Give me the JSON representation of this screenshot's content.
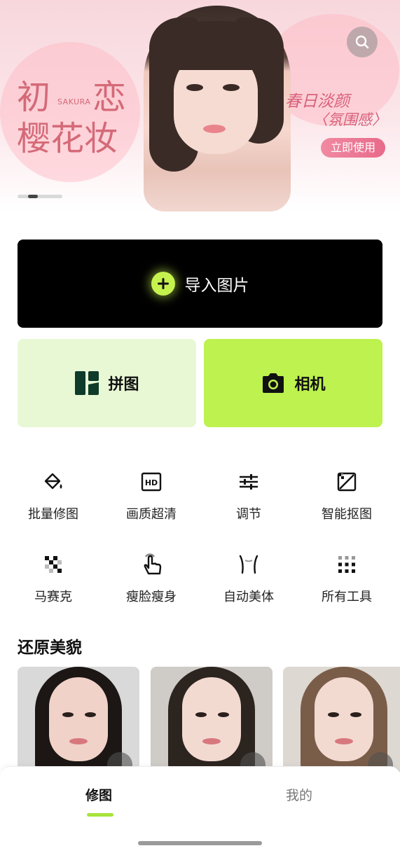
{
  "banner": {
    "title_line1_a": "初",
    "title_line1_b": "恋",
    "title_line2": "樱花妆",
    "sakura": "SAKURA",
    "subtitle1": "春日淡颜",
    "subtitle2": "〈氛围感〉",
    "cta": "立即使用",
    "page_indicator": {
      "current": 2,
      "total": 4
    }
  },
  "actions": {
    "import_label": "导入图片",
    "collage_label": "拼图",
    "camera_label": "相机"
  },
  "tools": [
    {
      "label": "批量修图",
      "icon": "paint-bucket-icon"
    },
    {
      "label": "画质超清",
      "icon": "hd-icon"
    },
    {
      "label": "调节",
      "icon": "sliders-icon"
    },
    {
      "label": "智能抠图",
      "icon": "cutout-icon"
    },
    {
      "label": "马赛克",
      "icon": "mosaic-icon"
    },
    {
      "label": "瘦脸瘦身",
      "icon": "hand-tap-icon"
    },
    {
      "label": "自动美体",
      "icon": "body-icon"
    },
    {
      "label": "所有工具",
      "icon": "grid-icon"
    }
  ],
  "section": {
    "title": "还原美貌"
  },
  "tabbar": {
    "tab1": "修图",
    "tab2": "我的"
  },
  "colors": {
    "accent": "#bdf24f",
    "accent_light": "#e8f8d5",
    "pink": "#d46a78"
  }
}
